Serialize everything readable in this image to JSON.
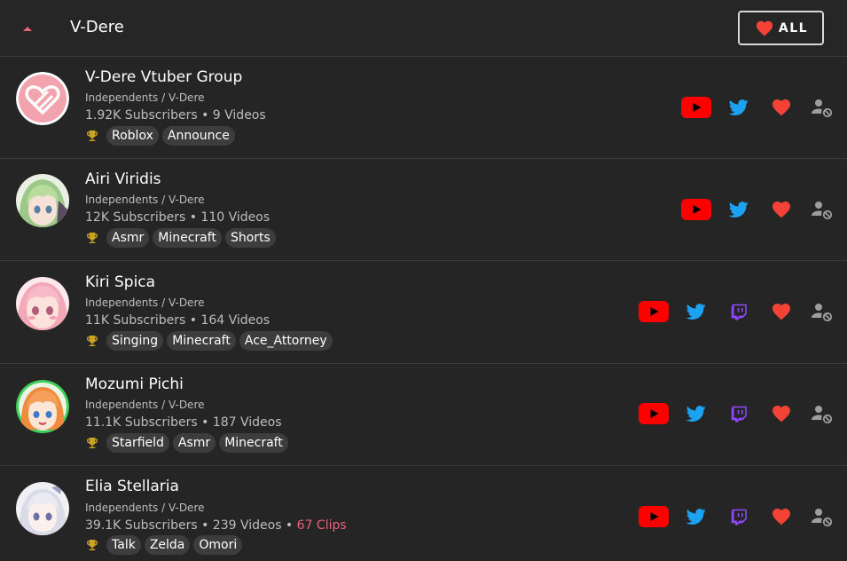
{
  "header": {
    "title": "V-Dere",
    "all_button_label": "ALL"
  },
  "colors": {
    "background": "#1e1e1e",
    "row_background": "#252525",
    "accent_pink": "#e8627a",
    "heart_red": "#f44336",
    "youtube_red": "#ff0000",
    "twitter_blue": "#1da1f2",
    "twitch_purple": "#9146ff",
    "tag_background": "#3d3d3d",
    "muted_text": "#bdbdbd"
  },
  "channels": [
    {
      "name": "V-Dere Vtuber Group",
      "org": "Independents / V-Dere",
      "stats": "1.92K Subscribers • 9 Videos",
      "clips": "",
      "tags": [
        "Roblox",
        "Announce"
      ],
      "avatar": "heart-logo-avatar",
      "links": [
        "youtube-icon",
        "twitter-icon"
      ]
    },
    {
      "name": "Airi Viridis",
      "org": "Independents / V-Dere",
      "stats": "12K Subscribers • 110 Videos",
      "clips": "",
      "tags": [
        "Asmr",
        "Minecraft",
        "Shorts"
      ],
      "avatar": "green-hair-avatar",
      "links": [
        "youtube-icon",
        "twitter-icon"
      ]
    },
    {
      "name": "Kiri Spica",
      "org": "Independents / V-Dere",
      "stats": "11K Subscribers • 164 Videos",
      "clips": "",
      "tags": [
        "Singing",
        "Minecraft",
        "Ace_Attorney"
      ],
      "avatar": "pink-hair-avatar",
      "links": [
        "youtube-icon",
        "twitter-icon",
        "twitch-icon"
      ]
    },
    {
      "name": "Mozumi Pichi",
      "org": "Independents / V-Dere",
      "stats": "11.1K Subscribers • 187 Videos",
      "clips": "",
      "tags": [
        "Starfield",
        "Asmr",
        "Minecraft"
      ],
      "avatar": "orange-hair-avatar",
      "links": [
        "youtube-icon",
        "twitter-icon",
        "twitch-icon"
      ]
    },
    {
      "name": "Elia Stellaria",
      "org": "Independents / V-Dere",
      "stats": "39.1K Subscribers • 239 Videos •",
      "clips": "67 Clips",
      "tags": [
        "Talk",
        "Zelda",
        "Omori"
      ],
      "avatar": "white-hair-avatar",
      "links": [
        "youtube-icon",
        "twitter-icon",
        "twitch-icon"
      ]
    }
  ]
}
